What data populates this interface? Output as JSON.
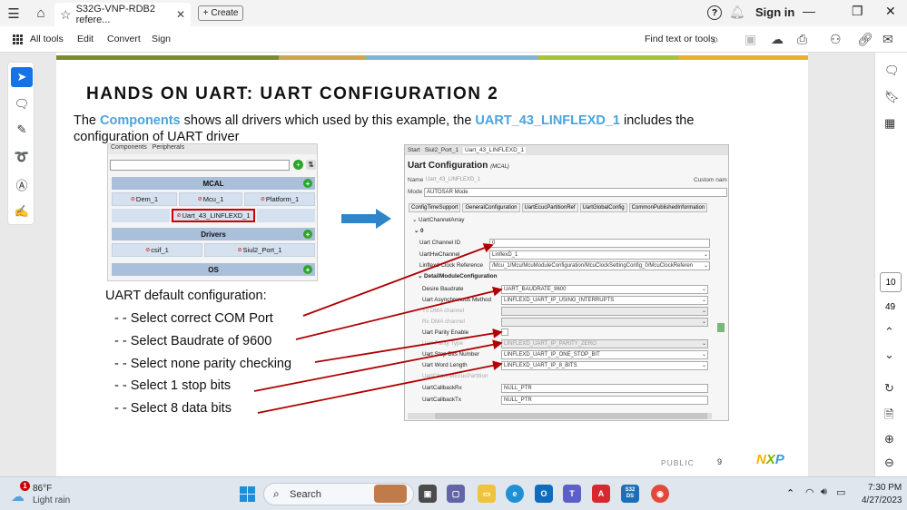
{
  "browser": {
    "tab_title": "S32G-VNP-RDB2 refere...",
    "create_label": "Create",
    "signin_label": "Sign in"
  },
  "menubar": {
    "all_tools": "All tools",
    "edit": "Edit",
    "convert": "Convert",
    "sign": "Sign",
    "find_text": "Find text or tools"
  },
  "pager": {
    "current_page": "10",
    "total_pages": "49"
  },
  "slide": {
    "title": "HANDS ON UART: UART CONFIGURATION 2",
    "intro_before": "The ",
    "intro_components": "Components",
    "intro_middle": " shows all drivers which used by this example, the ",
    "intro_uart": "UART_43_LINFLEXD_1",
    "intro_after": " includes the configuration of UART driver",
    "colorbar": [
      "#7b8c2e",
      "#c7a84a",
      "#7fb4d9",
      "#a7c33b",
      "#e8b02e"
    ],
    "components_panel": {
      "tab_components": "Components",
      "tab_peripherals": "Peripherals",
      "mcal_header": "MCAL",
      "drivers_header": "Drivers",
      "os_header": "OS",
      "mcal_modules": [
        "Dem_1",
        "Mcu_1",
        "Platform_1"
      ],
      "uart_module": "Uart_43_LINFLEXD_1",
      "driver_modules": [
        "csif_1",
        "Siul2_Port_1"
      ]
    },
    "config_label": "UART default configuration:",
    "bullets": [
      "- - Select correct COM Port",
      "- - Select Baudrate of 9600",
      "- - Select none parity checking",
      "- - Select 1 stop bits",
      "- - Select 8 data bits"
    ],
    "config_panel": {
      "tabs": [
        "Start",
        "Siul2_Port_1",
        "Uart_43_LINFLEXD_1"
      ],
      "title": "Uart Configuration",
      "title_suffix": "(MCAL)",
      "name_label": "Name",
      "name_value": "Uart_43_LINFLEXD_1",
      "custom_name": "Custom nam",
      "mode_label": "Mode",
      "mode_value": "AUTOSAR Mode",
      "section_tabs": [
        "ConfigTimeSupport",
        "GeneralConfiguration",
        "UartEcucPartitionRef",
        "UartGlobalConfig",
        "CommonPublishedInformation"
      ],
      "array_label": "UartChannelArray",
      "index_label": "0",
      "channel_id_label": "Uart Channel ID",
      "channel_id_value": "0",
      "hw_channel_label": "UartHwChannel",
      "hw_channel_value": "LinflexD_1",
      "clock_ref_label": "Linflexd Clock Reference",
      "clock_ref_value": "/Mcu_1/Mcu/McuModuleConfiguration/McuClockSettingConfig_0/McuClockReferen",
      "detail_section": "DetailModuleConfiguration",
      "baudrate_label": "Desire Baudrate",
      "baudrate_value": "UART_BAUDRATE_9600",
      "async_label": "Uart Asynchronous Method",
      "async_value": "LINFLEXD_UART_IP_USING_INTERRUPTS",
      "tx_dma_label": "Tx DMA channel",
      "rx_dma_label": "Rx DMA channel",
      "parity_enable_label": "Uart Parity Enable",
      "parity_type_label": "Uart Parity Type",
      "parity_type_value": "LINFLEXD_UART_IP_PARITY_ZERO",
      "stop_bits_label": "Uart Stop Bits Number",
      "stop_bits_value": "LINFLEXD_UART_IP_ONE_STOP_BIT",
      "word_length_label": "Uart Word Length",
      "word_length_value": "LINFLEXD_UART_IP_8_BITS",
      "partition_label": "UartChannelEcucPartition",
      "callback_rx_label": "UartCallbackRx",
      "callback_rx_value": "NULL_PTR",
      "callback_tx_label": "UartCallbackTx",
      "callback_tx_value": "NULL_PTR"
    },
    "footer_public": "PUBLIC",
    "footer_page": "9",
    "logo_text": "NXP"
  },
  "taskbar": {
    "temperature": "86°F",
    "weather": "Light rain",
    "weather_badge": "1",
    "search_label": "Search",
    "time": "7:30 PM",
    "date": "4/27/2023",
    "s32ds_label": "S32 DS"
  }
}
